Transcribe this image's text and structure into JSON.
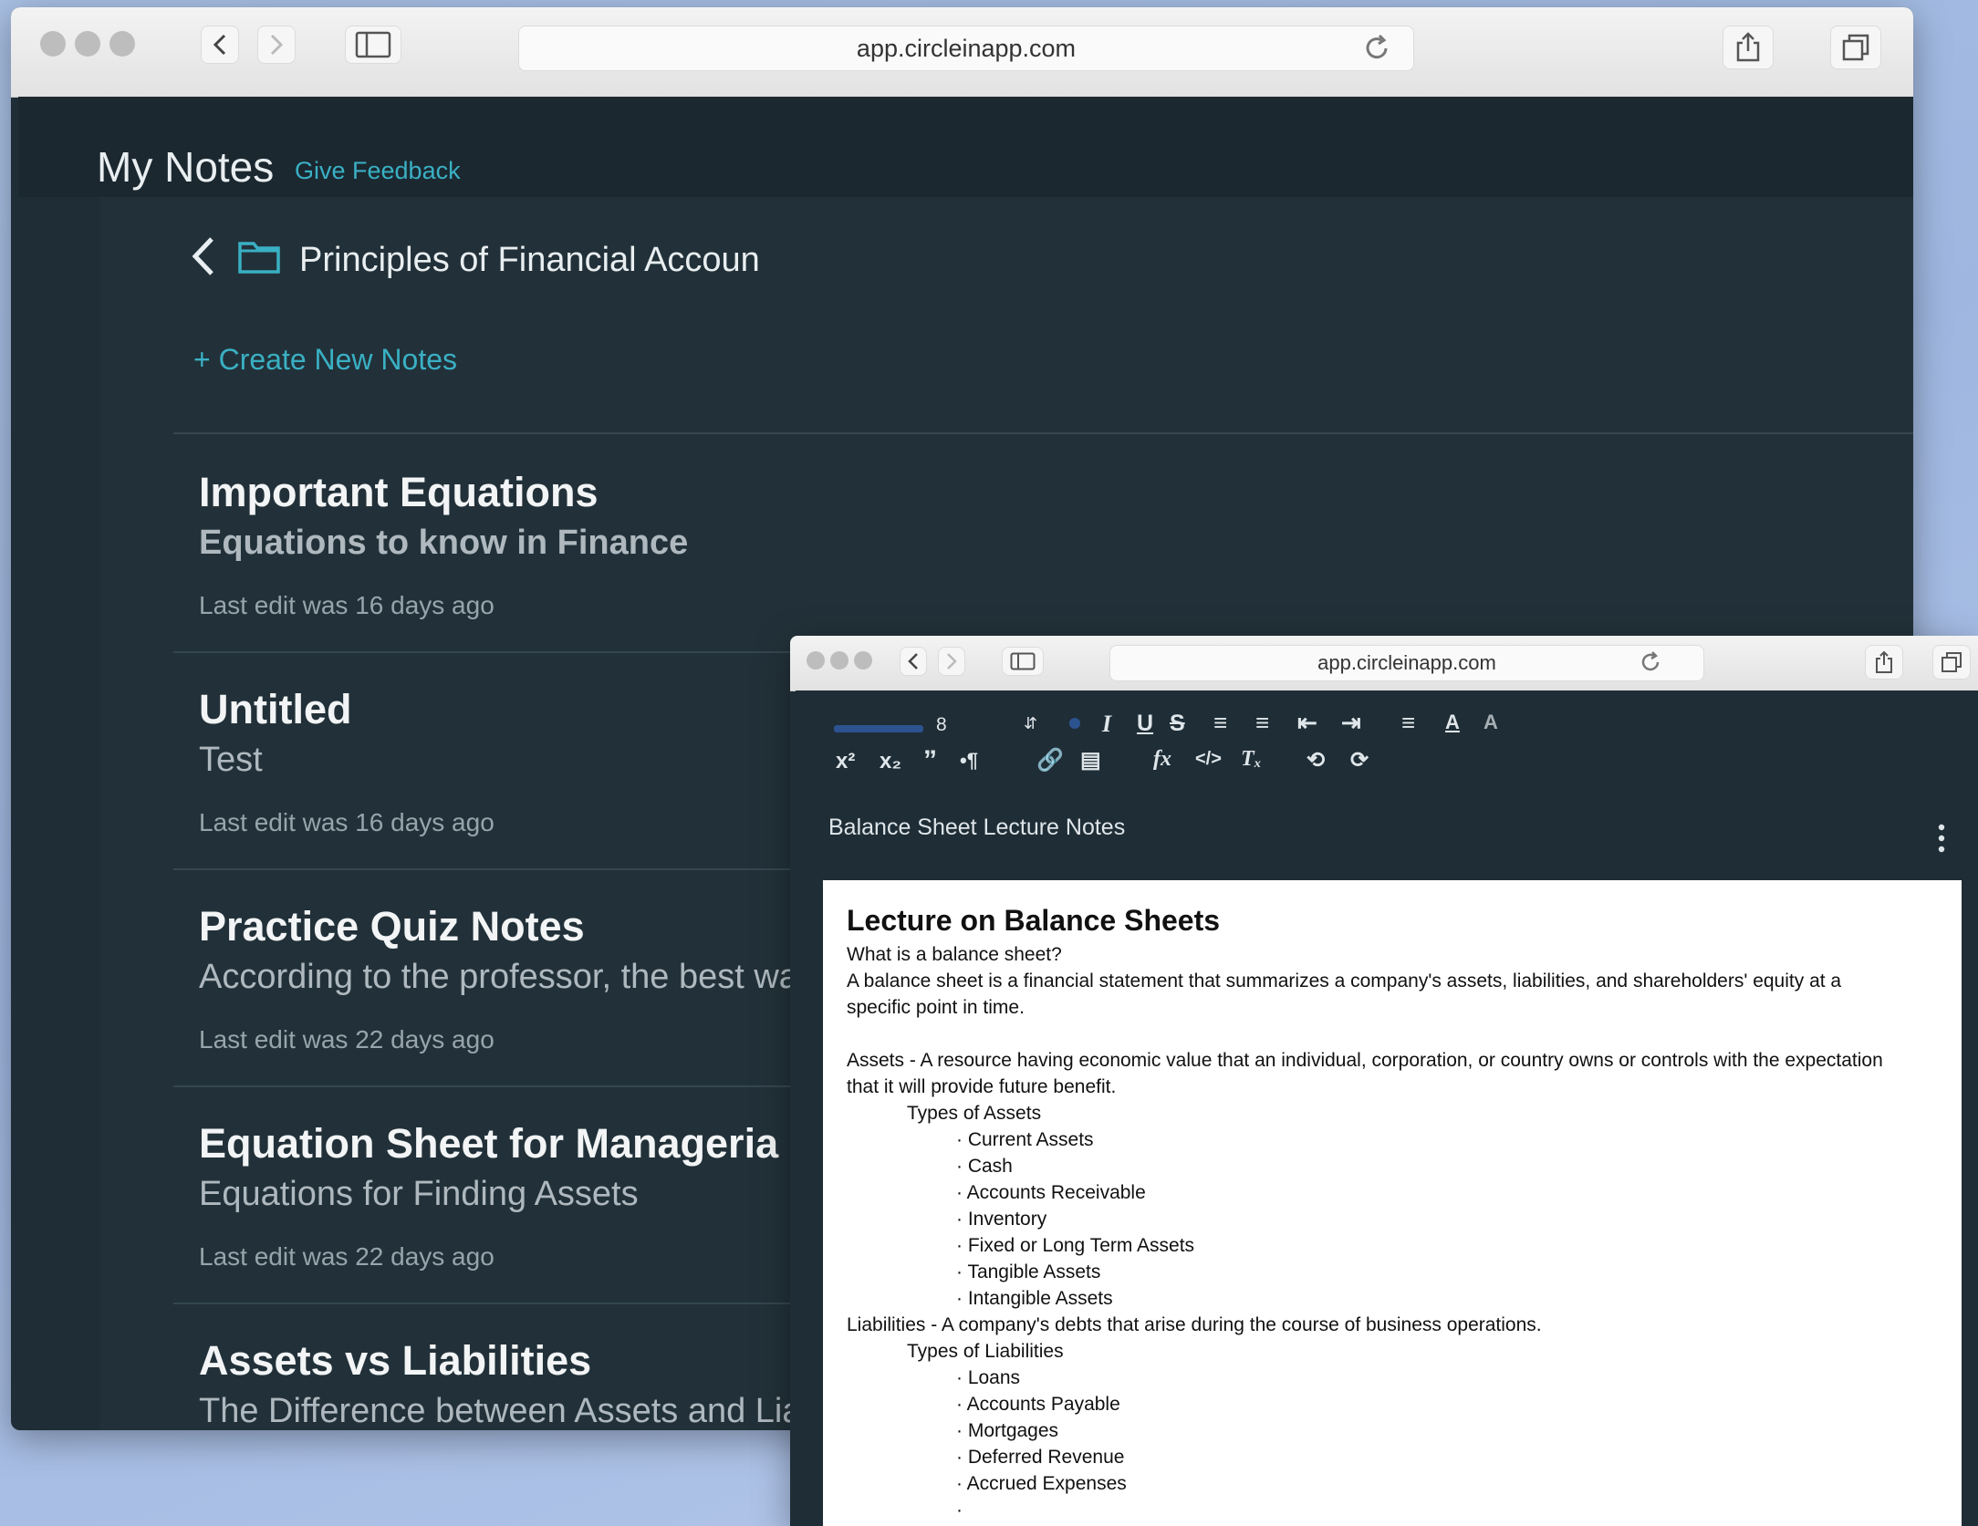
{
  "browser_main": {
    "url": "app.circleinapp.com"
  },
  "notes_app": {
    "title": "My Notes",
    "feedback_link": "Give Feedback",
    "folder_name": "Principles of Financial Accoun",
    "create_new": "+ Create New Notes",
    "notes": [
      {
        "title": "Important Equations",
        "subtitle": "Equations to know in Finance",
        "edited": "Last edit was 16 days ago"
      },
      {
        "title": "Untitled",
        "subtitle": "Test",
        "edited": "Last edit was 16 days ago"
      },
      {
        "title": "Practice Quiz Notes",
        "subtitle": "According to the professor, the best wa",
        "edited": "Last edit was 22 days ago"
      },
      {
        "title": "Equation Sheet for Manageria",
        "subtitle": "Equations for Finding Assets",
        "edited": "Last edit was 22 days ago"
      },
      {
        "title": "Assets vs Liabilities",
        "subtitle": "The Difference between Assets and Lia",
        "edited": ""
      }
    ]
  },
  "browser_editor": {
    "url": "app.circleinapp.com"
  },
  "editor": {
    "font_size": "8",
    "note_title": "Balance Sheet Lecture Notes",
    "toolbar_row1": [
      "italic-icon",
      "underline-icon",
      "strikethrough-icon",
      "ordered-list-icon",
      "bullet-list-icon",
      "outdent-icon",
      "indent-icon",
      "align-icon",
      "font-color-icon",
      "highlight-icon"
    ],
    "toolbar_row2": [
      "superscript-icon",
      "subscript-icon",
      "blockquote-icon",
      "rtl-icon",
      "link-icon",
      "video-icon",
      "formula-icon",
      "code-icon",
      "clear-format-icon",
      "undo-icon",
      "redo-icon"
    ],
    "document": {
      "heading": "Lecture on Balance Sheets",
      "q1": "What is a balance sheet?",
      "p1_line1": "A balance sheet is a financial statement that summarizes a company's assets, liabilities, and shareholders' equity at a",
      "p1_line2": "specific point in time.",
      "assets_line1": "Assets - A resource having economic value that an individual, corporation, or country owns or controls with the expectation",
      "assets_line2": "that it will provide future benefit.",
      "assets_types": "Types of Assets",
      "asset_items": [
        "Current Assets",
        "Cash",
        "Accounts Receivable",
        "Inventory",
        "Fixed or Long Term Assets",
        "Tangible Assets",
        "Intangible Assets"
      ],
      "liabilities_line": "Liabilities - A company's debts that arise during the course of business operations.",
      "liabilities_types": "Types of Liabilities",
      "liability_items": [
        "Loans",
        "Accounts Payable",
        "Mortgages",
        "Deferred Revenue",
        "Accrued Expenses",
        ""
      ]
    }
  },
  "colors": {
    "background": "#a9c0e4",
    "app_dark": "#1f2d36",
    "accent_teal": "#3ab0c4",
    "note_title": "#f2f4f5",
    "note_sub": "#aeb8be"
  }
}
